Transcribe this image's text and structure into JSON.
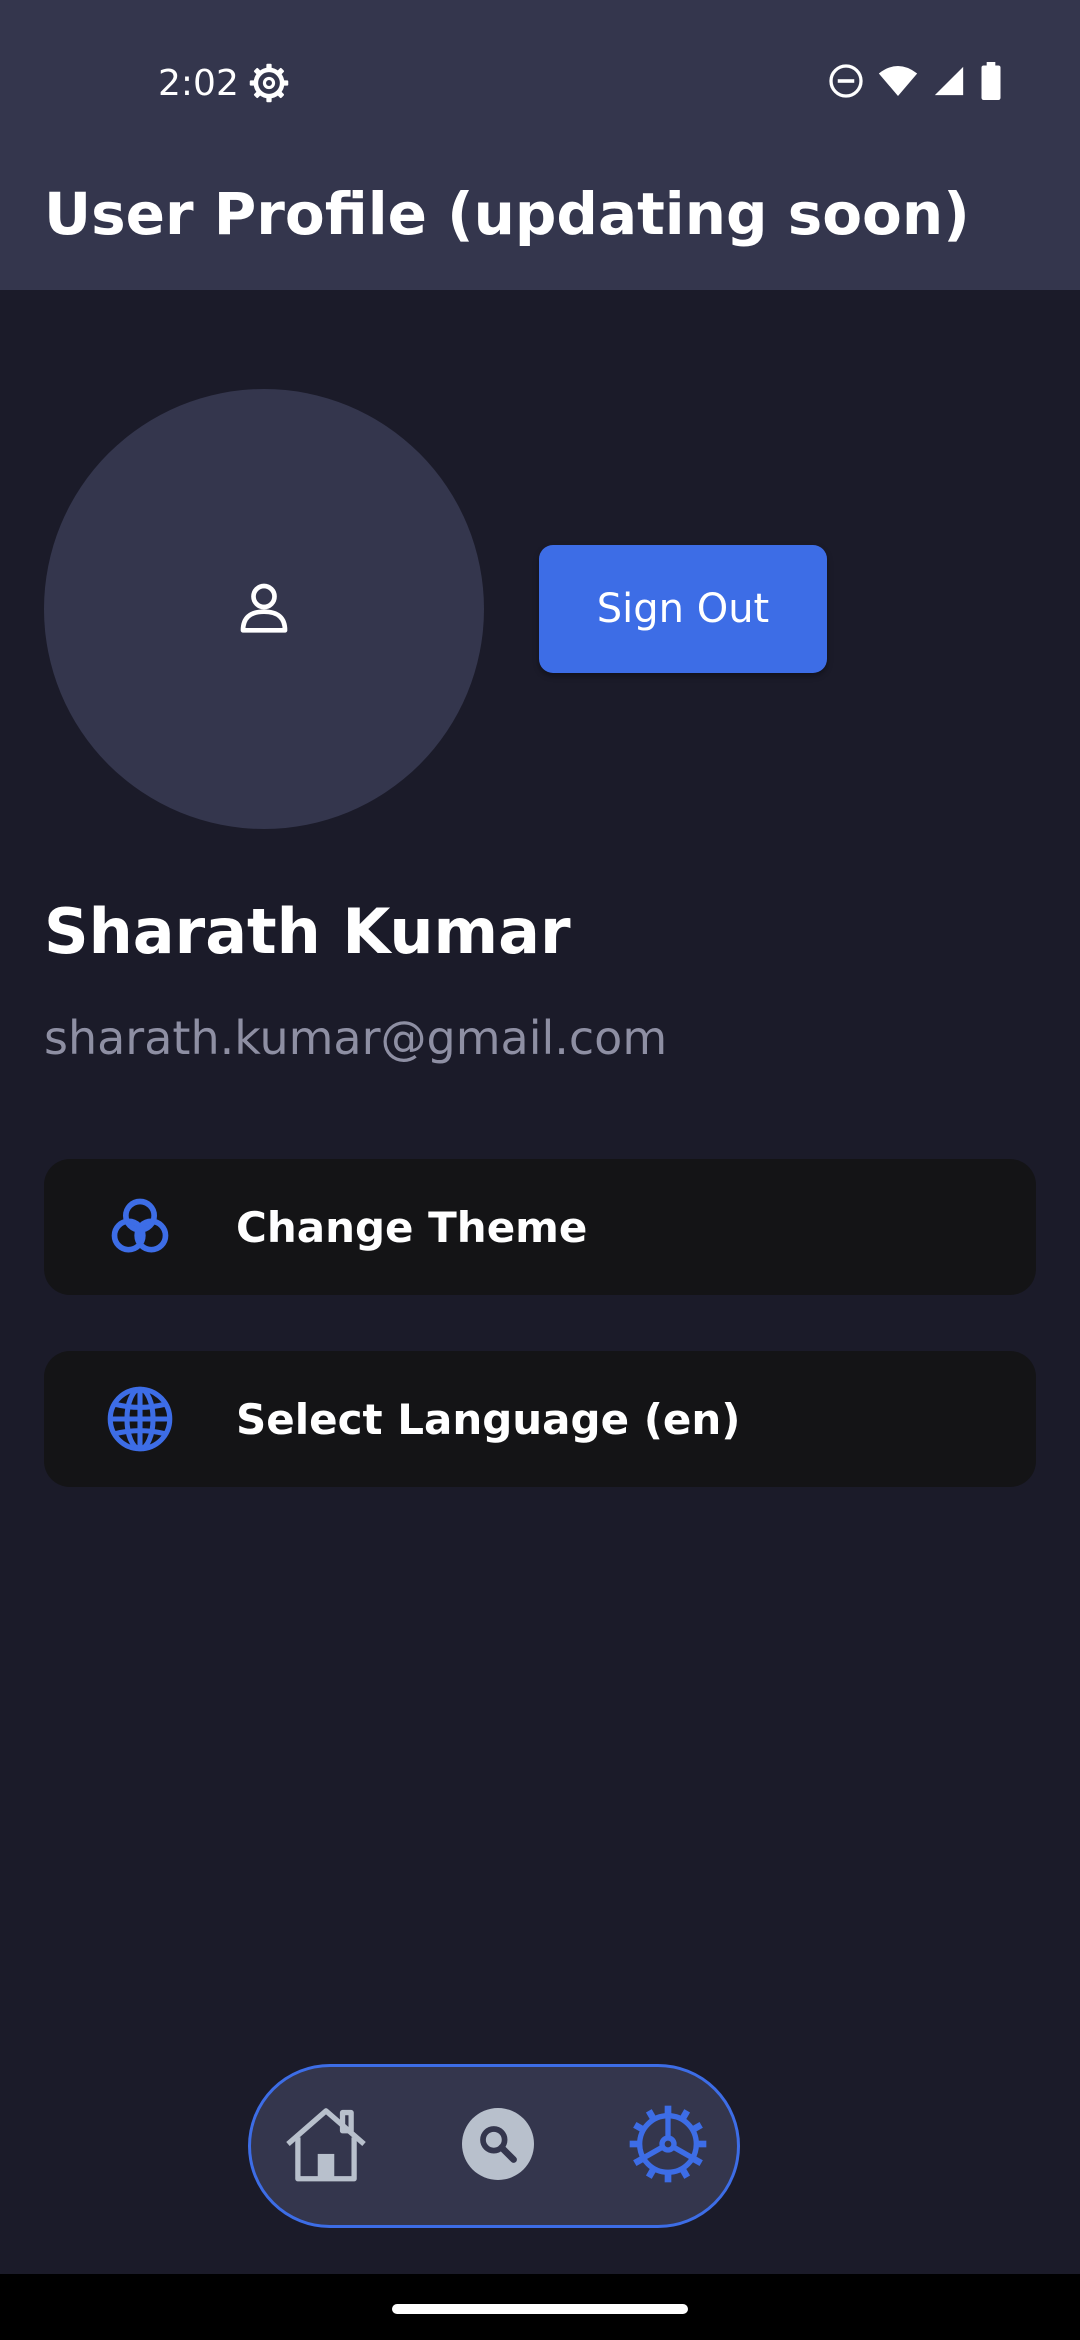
{
  "status_bar": {
    "time": "2:02",
    "icons": [
      "gear-icon",
      "do-not-disturb-icon",
      "wifi-icon",
      "cell-signal-icon",
      "battery-icon"
    ]
  },
  "app_bar": {
    "title": "User Profile (updating soon)"
  },
  "profile": {
    "avatar_icon": "person-icon",
    "sign_out_label": "Sign Out",
    "name": "Sharath Kumar",
    "email": "sharath.kumar@gmail.com"
  },
  "settings": {
    "items": [
      {
        "label": "Change Theme",
        "icon": "theme-circles-icon"
      },
      {
        "label": "Select Language (en)",
        "icon": "globe-icon"
      }
    ]
  },
  "bottom_nav": {
    "items": [
      {
        "icon": "home-icon",
        "active": false
      },
      {
        "icon": "search-icon",
        "active": false
      },
      {
        "icon": "settings-icon",
        "active": true
      }
    ]
  },
  "colors": {
    "background": "#1b1b29",
    "bar": "#34364d",
    "card": "#141416",
    "accent": "#3d6de6",
    "secondary_text": "#8e8fa3"
  }
}
